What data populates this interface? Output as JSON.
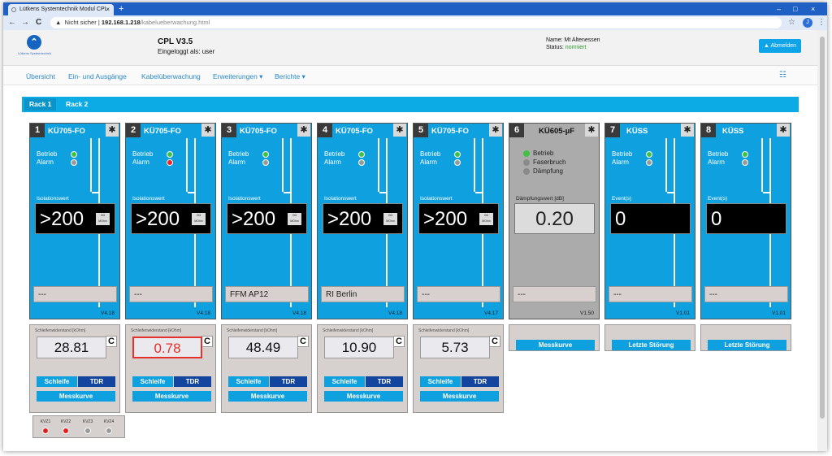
{
  "browser": {
    "tab_title": "Lütkens Systemtechnik Modul CPL",
    "tab_close": "×",
    "new_tab": "+",
    "window_controls": {
      "minimize": "–",
      "maximize": "□",
      "close": "×"
    },
    "nav": {
      "back": "←",
      "forward": "→",
      "reload": "C"
    },
    "address": {
      "security_icon": "▲",
      "security_text": "Nicht sicher",
      "separator": "|",
      "host": "192.168.1.218",
      "path": "/kabelueberwachung.html"
    },
    "star": "☆",
    "profile_initial": "J",
    "menu": "⋮"
  },
  "app": {
    "logo_text": "Lütkens Systemtechnik",
    "title": "CPL V3.5",
    "user_label": "Eingeloggt als: user",
    "name_label": "Name: Mt Altenessen",
    "status_label": "Status:",
    "status_value": "normiert",
    "logout_label": "▲ Abmelden",
    "status_color": "#2e9a2e",
    "accent_color": "#0fa0e0"
  },
  "nav": {
    "items": [
      {
        "label": "Übersicht"
      },
      {
        "label": "Ein- und Ausgänge"
      },
      {
        "label": "Kabelüberwachung"
      },
      {
        "label": "Erweiterungen ▾"
      },
      {
        "label": "Berichte ▾"
      }
    ],
    "menu_icon": "☷"
  },
  "racks": [
    {
      "label": "Rack 1",
      "active": true
    },
    {
      "label": "Rack 2",
      "active": false
    }
  ],
  "modules": [
    {
      "num": "1",
      "name": "KÜ705-FO",
      "gear": "✱",
      "led1": "Betrieb",
      "led2": "Alarm",
      "field_label": "Isolationswert",
      "value": ">200",
      "unit_top": "GΩ",
      "unit_bottom": "MOhm",
      "location": "---",
      "version": "V4.18"
    },
    {
      "num": "2",
      "name": "KÜ705-FO",
      "gear": "✱",
      "led1": "Betrieb",
      "led2": "Alarm",
      "field_label": "Isolationswert",
      "value": ">200",
      "unit_top": "GΩ",
      "unit_bottom": "MOhm",
      "location": "---",
      "version": "V4.18"
    },
    {
      "num": "3",
      "name": "KÜ705-FO",
      "gear": "✱",
      "led1": "Betrieb",
      "led2": "Alarm",
      "field_label": "Isolationswert",
      "value": ">200",
      "unit_top": "GΩ",
      "unit_bottom": "MOhm",
      "location": "FFM AP12",
      "version": "V4.18"
    },
    {
      "num": "4",
      "name": "KÜ705-FO",
      "gear": "✱",
      "led1": "Betrieb",
      "led2": "Alarm",
      "field_label": "Isolationswert",
      "value": ">200",
      "unit_top": "GΩ",
      "unit_bottom": "MOhm",
      "location": "RI Berlin",
      "version": "V4.18"
    },
    {
      "num": "5",
      "name": "KÜ705-FO",
      "gear": "✱",
      "led1": "Betrieb",
      "led2": "Alarm",
      "field_label": "Isolationswert",
      "value": ">200",
      "unit_top": "GΩ",
      "unit_bottom": "MOhm",
      "location": "---",
      "version": "V4.17"
    },
    {
      "num": "6",
      "name": "KÜ605-µF",
      "gear": "✱",
      "led1": "Betrieb",
      "led2": "Faserbruch",
      "led3": "Dämpfung",
      "field_label": "Dämpfungswert [dB]",
      "value": "0.20",
      "location": "---",
      "version": "V1.50"
    },
    {
      "num": "7",
      "name": "KÜSS",
      "gear": "✱",
      "led1": "Betrieb",
      "led2": "Alarm",
      "field_label": "Event(s)",
      "value": "0",
      "location": "---",
      "version": "V1.01"
    },
    {
      "num": "8",
      "name": "KÜSS",
      "gear": "✱",
      "led1": "Betrieb",
      "led2": "Alarm",
      "field_label": "Event(s)",
      "value": "0",
      "location": "---",
      "version": "V1.01"
    }
  ],
  "resistance": [
    {
      "label": "Schleifenwiderstand [kOhm]",
      "value": "28.81",
      "refresh": "C",
      "btn_loop": "Schleife",
      "btn_tdr": "TDR",
      "btn_curve": "Messkurve"
    },
    {
      "label": "Schleifenwiderstand [kOhm]",
      "value": "0.78",
      "refresh": "C",
      "btn_loop": "Schleife",
      "btn_tdr": "TDR",
      "btn_curve": "Messkurve"
    },
    {
      "label": "Schleifenwiderstand [kOhm]",
      "value": "48.49",
      "refresh": "C",
      "btn_loop": "Schleife",
      "btn_tdr": "TDR",
      "btn_curve": "Messkurve"
    },
    {
      "label": "Schleifenwiderstand [kOhm]",
      "value": "10.90",
      "refresh": "C",
      "btn_loop": "Schleife",
      "btn_tdr": "TDR",
      "btn_curve": "Messkurve"
    },
    {
      "label": "Schleifenwiderstand [kOhm]",
      "value": "5.73",
      "refresh": "C",
      "btn_loop": "Schleife",
      "btn_tdr": "TDR",
      "btn_curve": "Messkurve"
    }
  ],
  "extra_buttons": [
    {
      "label": "Messkurve"
    },
    {
      "label": "Letzte Störung"
    },
    {
      "label": "Letzte Störung"
    }
  ],
  "kvz": [
    {
      "label": "KVZ1",
      "color": "#e81c1c"
    },
    {
      "label": "KVZ2",
      "color": "#e81c1c"
    },
    {
      "label": "KVZ3",
      "color": "#9a9a9a"
    },
    {
      "label": "KVZ4",
      "color": "#9a9a9a"
    }
  ]
}
